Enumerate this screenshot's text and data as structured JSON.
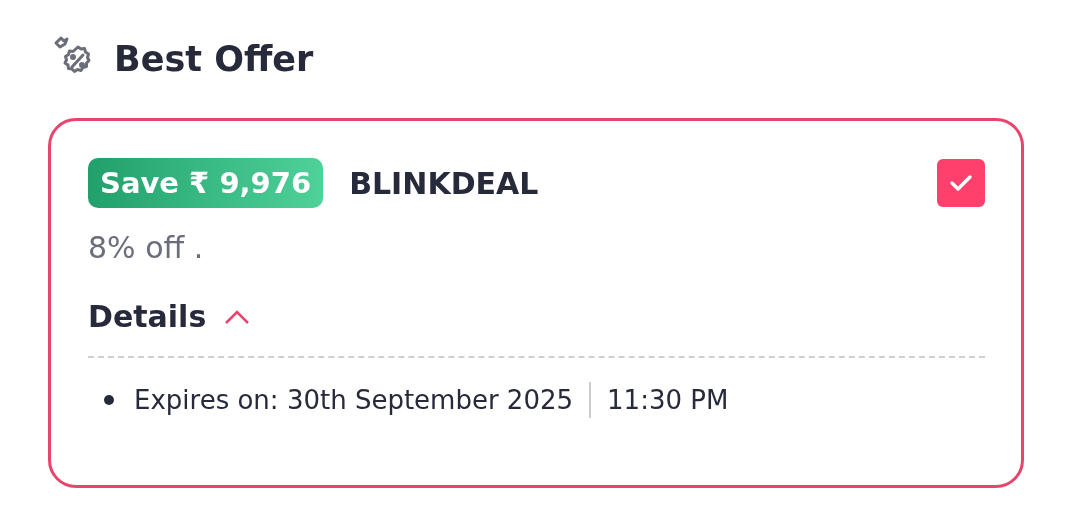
{
  "title": "Best Offer",
  "offer": {
    "savings": "Save ₹ 9,976",
    "code": "BLINKDEAL",
    "checked": true,
    "description": "8% off .",
    "details": {
      "label": "Details",
      "expanded": true,
      "items": [
        {
          "text": "Expires on: 30th September 2025",
          "time": "11:30 PM"
        }
      ]
    }
  }
}
